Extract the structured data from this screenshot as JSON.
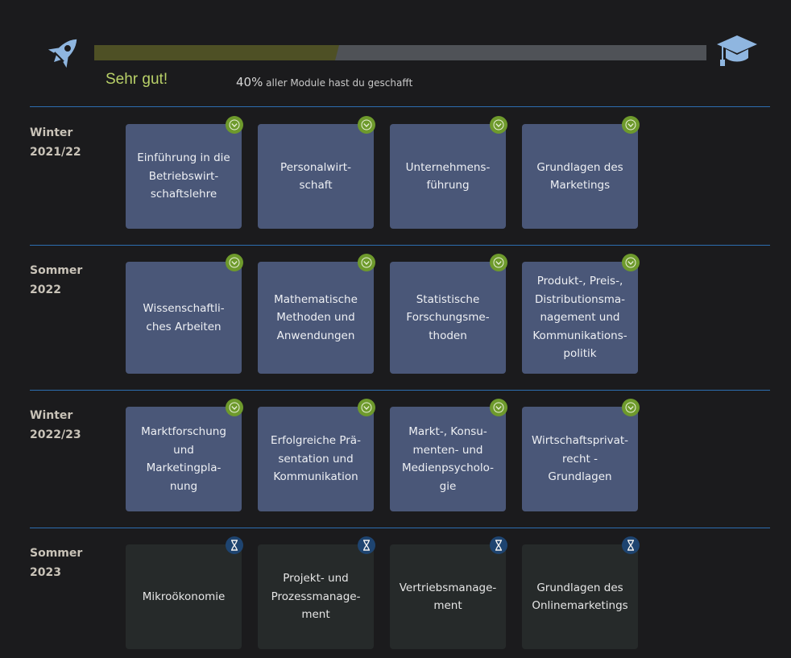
{
  "progress": {
    "praise": "Sehr gut!",
    "percent_label": "40%",
    "text": "aller Module hast du geschafft",
    "percent": 40
  },
  "colors": {
    "background": "#1b1b1d",
    "progress_fill": "#4e5025",
    "progress_track": "#4f5257",
    "module_done": "#4a5778",
    "module_pending": "#262a2a",
    "badge_done": "#6e9a2c",
    "badge_pending": "#1e4470",
    "divider": "#2d6eb0",
    "praise": "#b9d168"
  },
  "icons": {
    "start": "rocket-icon",
    "goal": "graduation-cap-icon",
    "done": "check-badge-icon",
    "pending": "hourglass-icon"
  },
  "semesters": [
    {
      "label_line1": "Winter",
      "label_line2": "2021/22",
      "modules": [
        {
          "title": "Einführung in die\nBetriebswirt-\nschaftslehre",
          "status": "done"
        },
        {
          "title": "Personalwirt-\nschaft",
          "status": "done"
        },
        {
          "title": "Unternehmens-\nführung",
          "status": "done"
        },
        {
          "title": "Grundlagen des\nMarketings",
          "status": "done"
        }
      ]
    },
    {
      "label_line1": "Sommer",
      "label_line2": "2022",
      "modules": [
        {
          "title": "Wissenschaftli-\nches Arbeiten",
          "status": "done"
        },
        {
          "title": "Mathematische\nMethoden und\nAnwendungen",
          "status": "done"
        },
        {
          "title": "Statistische\nForschungsme-\nthoden",
          "status": "done"
        },
        {
          "title": "Produkt-, Preis-,\nDistributionsma-\nnagement und\nKommunikations-\npolitik",
          "status": "done"
        }
      ]
    },
    {
      "label_line1": "Winter",
      "label_line2": "2022/23",
      "modules": [
        {
          "title": "Marktforschung\nund\nMarketingpla-\nnung",
          "status": "done"
        },
        {
          "title": "Erfolgreiche Prä-\nsentation und\nKommunikation",
          "status": "done"
        },
        {
          "title": "Markt-, Konsu-\nmenten- und\nMedienpsycholo-\ngie",
          "status": "done"
        },
        {
          "title": "Wirtschaftsprivat-\nrecht -\nGrundlagen",
          "status": "done"
        }
      ]
    },
    {
      "label_line1": "Sommer",
      "label_line2": "2023",
      "modules": [
        {
          "title": "Mikroökonomie",
          "status": "pending"
        },
        {
          "title": "Projekt- und\nProzessmanage-\nment",
          "status": "pending"
        },
        {
          "title": "Vertriebsmanage-\nment",
          "status": "pending"
        },
        {
          "title": "Grundlagen des\nOnlinemarketings",
          "status": "pending"
        }
      ]
    }
  ]
}
